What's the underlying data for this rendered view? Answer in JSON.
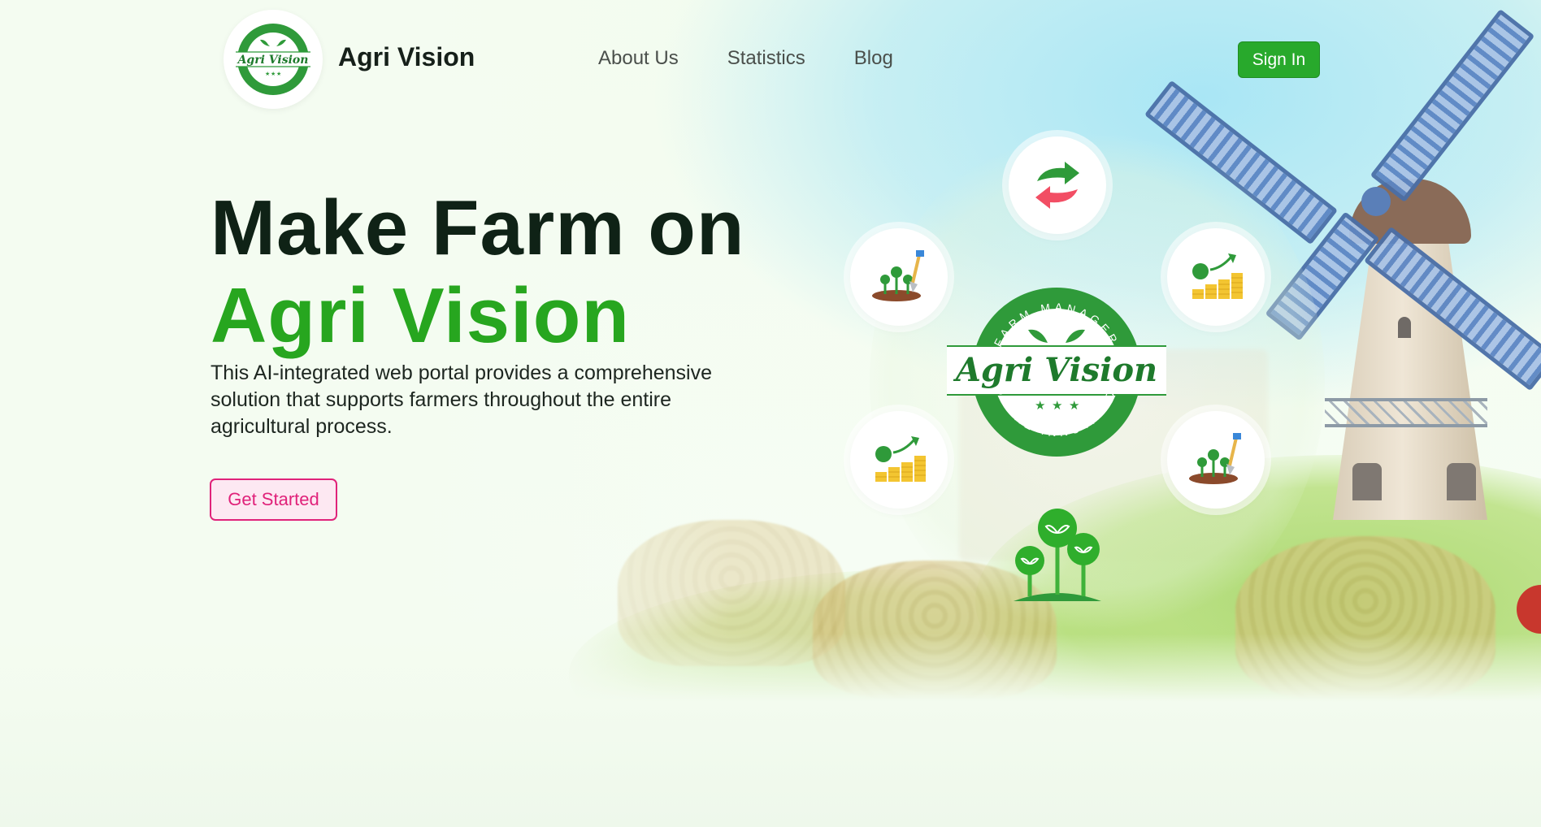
{
  "brand": {
    "name": "Agri Vision",
    "logo_text": "Agri Vision",
    "logo_top_arc": "FARM MANAGER",
    "logo_bottom_arc": "FUTURE INNOVATION"
  },
  "nav": {
    "items": [
      {
        "label": "About Us"
      },
      {
        "label": "Statistics"
      },
      {
        "label": "Blog"
      }
    ],
    "signin_label": "Sign In"
  },
  "hero": {
    "line1": "Make Farm on",
    "line2": "Agri Vision",
    "description": "This AI-integrated web portal provides a comprehensive solution that supports farmers throughout the entire agricultural process.",
    "cta_label": "Get Started"
  },
  "badge": {
    "top_arc": "FARM MANAGER",
    "title": "Agri Vision",
    "bottom_arc": "FUTURE INNOVATION"
  },
  "icons": {
    "sync": "sync-arrows-icon",
    "sprout_shovel": "sprout-shovel-icon",
    "coins_growth": "coins-growth-icon",
    "plants": "plants-icon"
  },
  "colors": {
    "accent_green": "#27a61f",
    "signin_green": "#28a92c",
    "cta_pink": "#e0227a",
    "dark_text": "#0f2216"
  }
}
